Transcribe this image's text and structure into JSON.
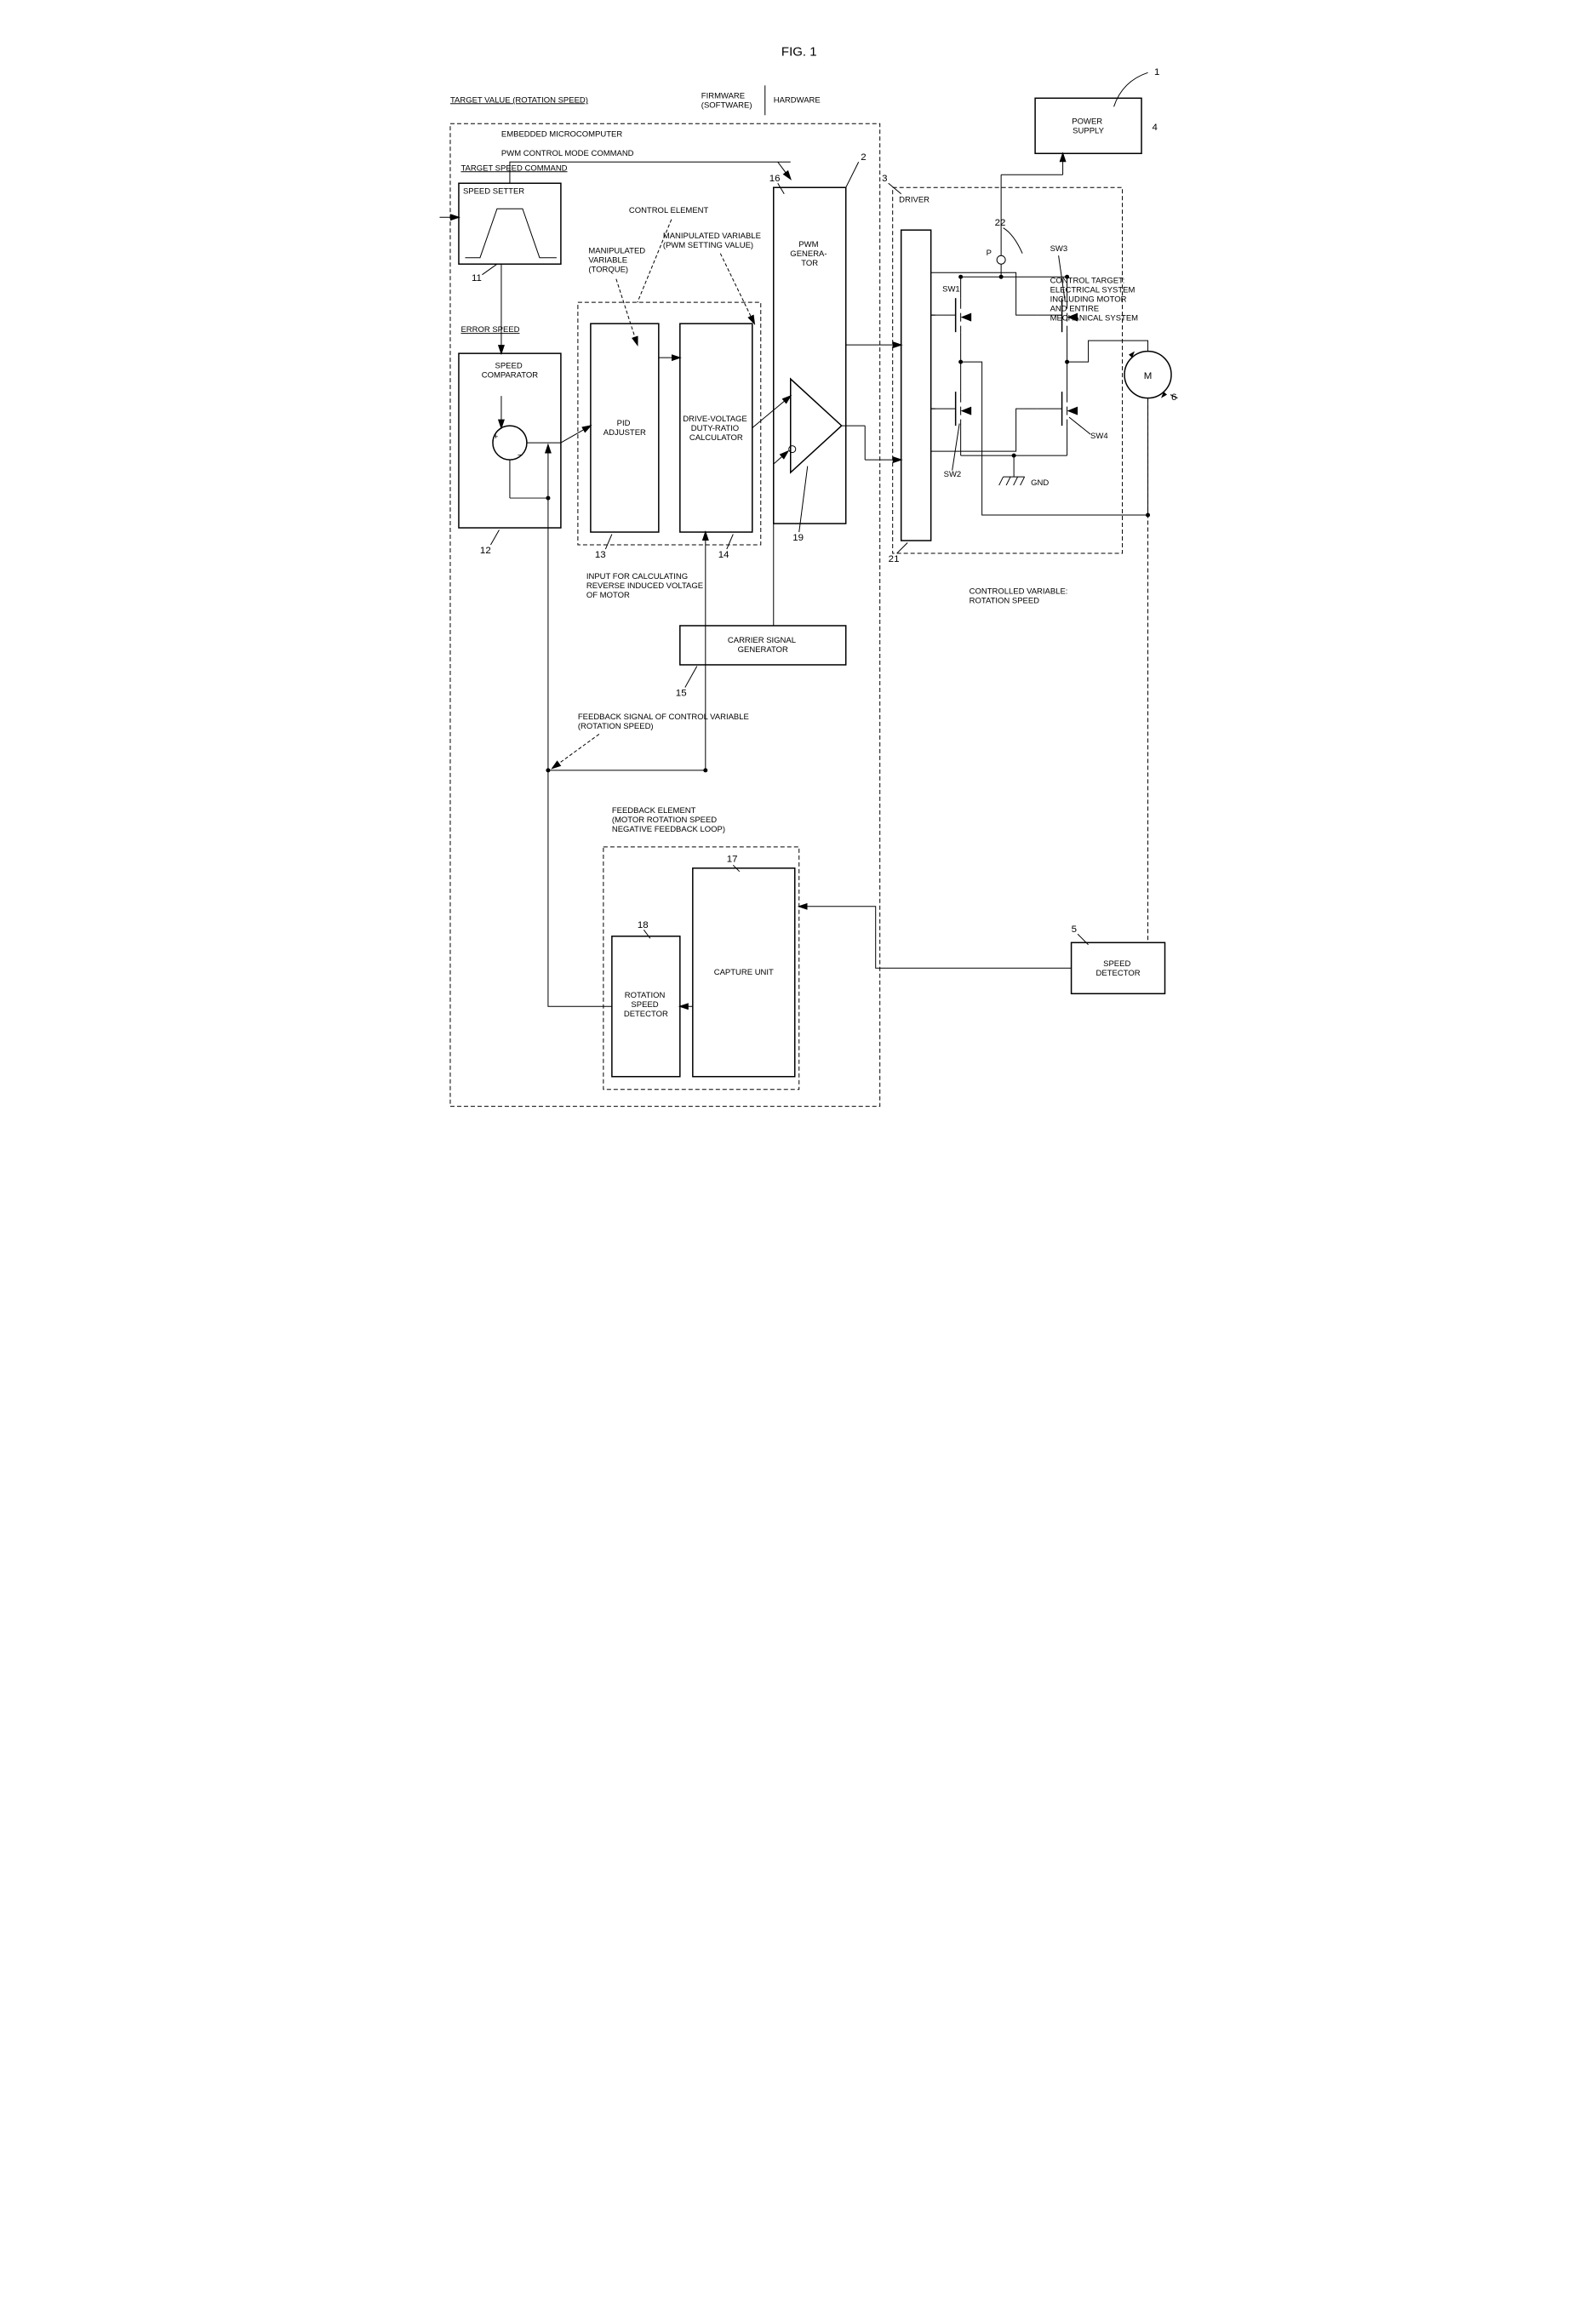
{
  "title": "FIG. 1",
  "ref_main": "1",
  "blocks": {
    "power_supply": {
      "label": "POWER\nSUPPLY",
      "num": "4"
    },
    "speed_setter": {
      "label": "SPEED SETTER",
      "num": "11"
    },
    "speed_comparator": {
      "label": "SPEED\nCOMPARATOR",
      "num": "12"
    },
    "pid_adjuster": {
      "label": "PID\nADJUSTER",
      "num": "13"
    },
    "duty_calc": {
      "label": "DRIVE-VOLTAGE\nDUTY-RATIO\nCALCULATOR",
      "num": "14"
    },
    "carrier_gen": {
      "label": "CARRIER SIGNAL\nGENERATOR",
      "num": "15"
    },
    "pwm_gen": {
      "label": "PWM\nGENERA-\nTOR",
      "num": "16"
    },
    "capture": {
      "label": "CAPTURE UNIT",
      "num": "17"
    },
    "rot_speed_det": {
      "label": "ROTATION\nSPEED\nDETECTOR",
      "num": "18"
    },
    "speed_det": {
      "label": "SPEED\nDETECTOR",
      "num": "5"
    },
    "motor": {
      "label": "M",
      "num": "6"
    },
    "driver": {
      "label": "DRIVER",
      "num": "3"
    },
    "predriver": {
      "num": "21"
    },
    "bridge": {
      "num": "22"
    },
    "comparator_num": "19",
    "mcu_num": "2"
  },
  "switches": {
    "sw1": "SW1",
    "sw2": "SW2",
    "sw3": "SW3",
    "sw4": "SW4"
  },
  "pins": {
    "p": "P",
    "gnd": "GND"
  },
  "signs": {
    "plus": "+",
    "minus": "−"
  },
  "annotations": {
    "target_value": "TARGET VALUE (ROTATION SPEED)",
    "target_speed_cmd": "TARGET SPEED COMMAND",
    "error_speed": "ERROR SPEED",
    "firmware": "FIRMWARE\n(SOFTWARE)",
    "hardware": "HARDWARE",
    "embedded_mcu": "EMBEDDED MICROCOMPUTER",
    "pwm_mode_cmd": "PWM CONTROL MODE COMMAND",
    "control_element": "CONTROL ELEMENT",
    "manip_torque": "MANIPULATED\nVARIABLE\n(TORQUE)",
    "manip_pwm": "MANIPULATED VARIABLE\n(PWM SETTING VALUE)",
    "input_reverse": "INPUT FOR CALCULATING\nREVERSE INDUCED VOLTAGE\nOF MOTOR",
    "feedback_signal": "FEEDBACK SIGNAL OF CONTROL VARIABLE\n(ROTATION SPEED)",
    "feedback_element": "FEEDBACK ELEMENT\n(MOTOR ROTATION SPEED\nNEGATIVE FEEDBACK LOOP)",
    "control_target": "CONTROL TARGET:\nELECTRICAL SYSTEM\nINCLUDING MOTOR\nAND ENTIRE\nMECHANICAL SYSTEM",
    "controlled_var": "CONTROLLED VARIABLE:\nROTATION SPEED"
  }
}
